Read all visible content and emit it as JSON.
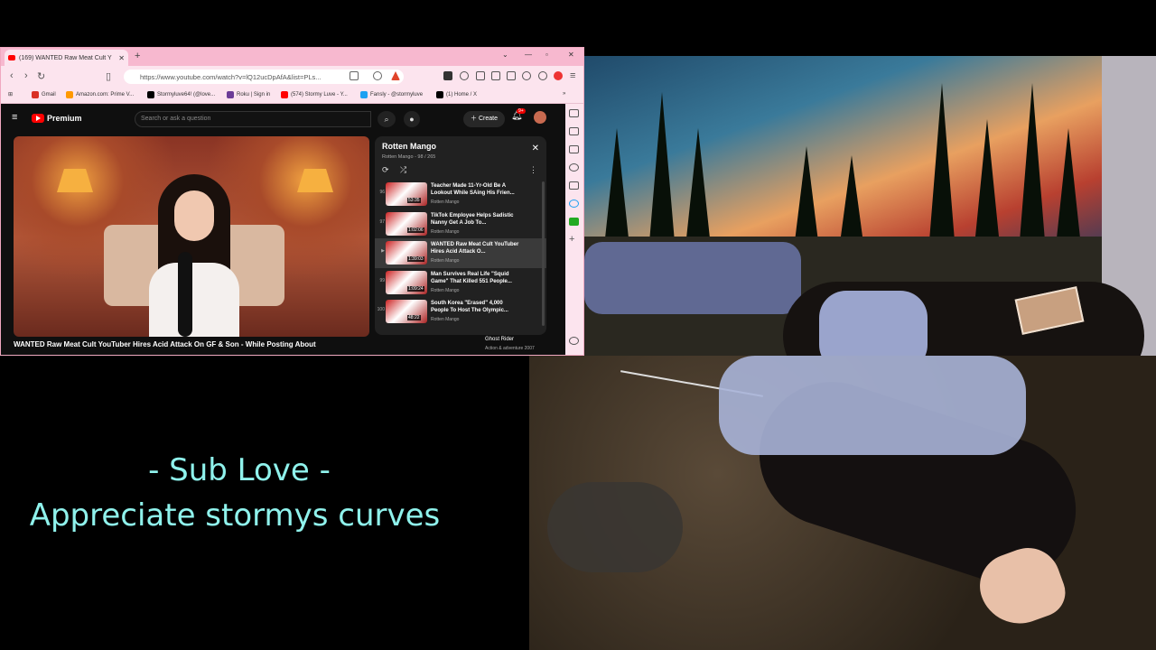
{
  "browser": {
    "tab_title": "(169) WANTED Raw Meat Cult Y",
    "url": "https://www.youtube.com/watch?v=lQ12ucDpAfA&list=PLs...",
    "bookmarks": [
      {
        "label": "Gmail",
        "color": "#d93025"
      },
      {
        "label": "Amazon.com: Prime V...",
        "color": "#ff9900"
      },
      {
        "label": "Stormyluve64! (@love...",
        "color": "#000000"
      },
      {
        "label": "Roku | Sign in",
        "color": "#6c3c97"
      },
      {
        "label": "(574) Stormy Luve - Y...",
        "color": "#ff0000"
      },
      {
        "label": "Fansly - @stormyluve",
        "color": "#1da1f2"
      },
      {
        "label": "(1) Home / X",
        "color": "#000000"
      }
    ]
  },
  "youtube": {
    "logo_text": "Premium",
    "search_placeholder": "Search or ask a question",
    "create_label": "Create",
    "notification_count": "9+",
    "video_title": "WANTED Raw Meat Cult YouTuber Hires Acid Attack On GF & Son - While Posting About",
    "playlist": {
      "title": "Rotten Mango",
      "subtitle": "Rotten Mango - 98 / 265",
      "items": [
        {
          "num": "96",
          "title": "Teacher Made 11-Yr-Old Be A Lookout While SAing His Frien...",
          "channel": "Rotten Mango",
          "duration": "53:35",
          "active": false
        },
        {
          "num": "97",
          "title": "TikTok Employee Helps Sadistic Nanny Get A Job To...",
          "channel": "Rotten Mango",
          "duration": "1:02:06",
          "active": false
        },
        {
          "num": "▶",
          "title": "WANTED Raw Meat Cult YouTuber Hires Acid Attack O...",
          "channel": "Rotten Mango",
          "duration": "1:39:03",
          "active": true
        },
        {
          "num": "99",
          "title": "Man Survives Real Life \"Squid Game\" That Killed 551 People...",
          "channel": "Rotten Mango",
          "duration": "1:09:24",
          "active": false
        },
        {
          "num": "100",
          "title": "South Korea \"Erased\" 4,000 People To Host The Olympic...",
          "channel": "Rotten Mango",
          "duration": "48:22",
          "active": false
        }
      ]
    },
    "recommended": {
      "title": "Ghost Rider",
      "subtitle": "Action & adventure 2007"
    }
  },
  "overlay": {
    "line1": "- Sub Love -",
    "line2": "Appreciate stormys curves",
    "color": "#8ff2ec"
  }
}
